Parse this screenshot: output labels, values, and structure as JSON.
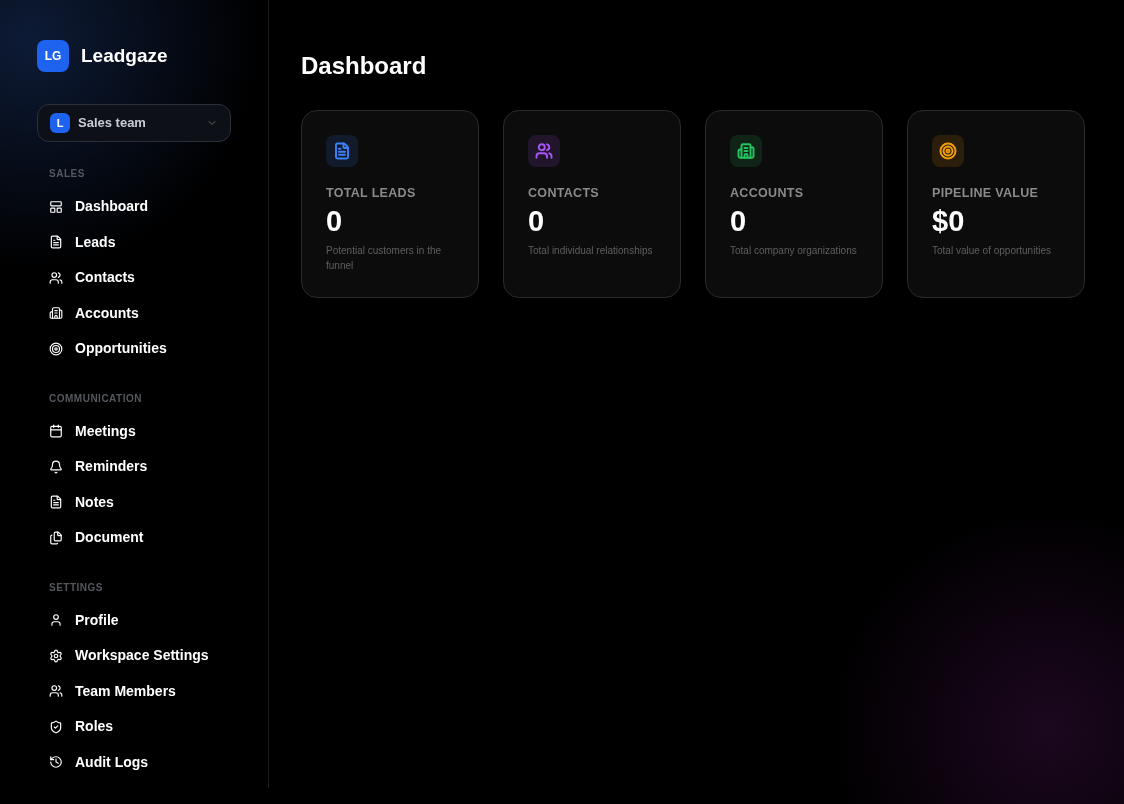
{
  "brand": {
    "logo": "LG",
    "name": "Leadgaze"
  },
  "workspace": {
    "initial": "L",
    "name": "Sales team"
  },
  "sidebar": {
    "sections": [
      {
        "title": "SALES",
        "items": [
          {
            "label": "Dashboard"
          },
          {
            "label": "Leads"
          },
          {
            "label": "Contacts"
          },
          {
            "label": "Accounts"
          },
          {
            "label": "Opportunities"
          }
        ]
      },
      {
        "title": "COMMUNICATION",
        "items": [
          {
            "label": "Meetings"
          },
          {
            "label": "Reminders"
          },
          {
            "label": "Notes"
          },
          {
            "label": "Document"
          }
        ]
      },
      {
        "title": "SETTINGS",
        "items": [
          {
            "label": "Profile"
          },
          {
            "label": "Workspace Settings"
          },
          {
            "label": "Team Members"
          },
          {
            "label": "Roles"
          },
          {
            "label": "Audit Logs"
          }
        ]
      }
    ]
  },
  "page": {
    "title": "Dashboard"
  },
  "stats": [
    {
      "label": "TOTAL LEADS",
      "value": "0",
      "caption": "Potential customers in the funnel",
      "color": "#3b82f6"
    },
    {
      "label": "CONTACTS",
      "value": "0",
      "caption": "Total individual relationships",
      "color": "#a855f7"
    },
    {
      "label": "ACCOUNTS",
      "value": "0",
      "caption": "Total company organizations",
      "color": "#22c55e"
    },
    {
      "label": "PIPELINE VALUE",
      "value": "$0",
      "caption": "Total value of opportunities",
      "color": "#f59e0b"
    }
  ]
}
